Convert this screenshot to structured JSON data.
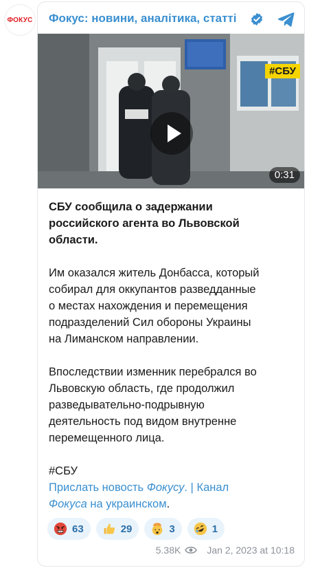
{
  "avatar": {
    "logo_text": "ФОКУС"
  },
  "header": {
    "channel_name": "Фокус: новини, аналітика, статті"
  },
  "video": {
    "duration": "0:31",
    "badge": "#СБУ"
  },
  "post": {
    "headline_lines": [
      "СБУ сообщила о задержании",
      "российского агента во Львовской",
      "области."
    ],
    "paragraph1_lines": [
      "Им оказался житель Донбасса, который",
      "собирал для оккупантов разведданные",
      "о местах нахождения и перемещения",
      "подразделений Сил обороны Украины",
      "на Лиманском направлении."
    ],
    "paragraph2_lines": [
      "Впоследствии изменник перебрался во",
      "Львовскую область, где продолжил",
      "разведывательно-подрывную",
      "деятельность под видом внутренне",
      "перемещенного лица."
    ],
    "hashtag": "#СБУ",
    "links": {
      "send_news": "Прислать новость",
      "fokusu": "Фокусу",
      "dot_sep": ". |",
      "channel": "Канал",
      "fokusa": "Фокуса",
      "in_ukrainian": "на украинском",
      "end": "."
    }
  },
  "reactions": [
    {
      "emoji": "angry-face-icon",
      "count": "63"
    },
    {
      "emoji": "thumbs-up-icon",
      "count": "29"
    },
    {
      "emoji": "exploding-head-icon",
      "count": "3"
    },
    {
      "emoji": "rofl-icon",
      "count": "1"
    }
  ],
  "meta": {
    "views": "5.38K",
    "timestamp": "Jan 2, 2023 at 10:18"
  },
  "colors": {
    "accent": "#3a8fd0",
    "logo_red": "#e01b22",
    "badge_yellow": "#f5d400"
  }
}
